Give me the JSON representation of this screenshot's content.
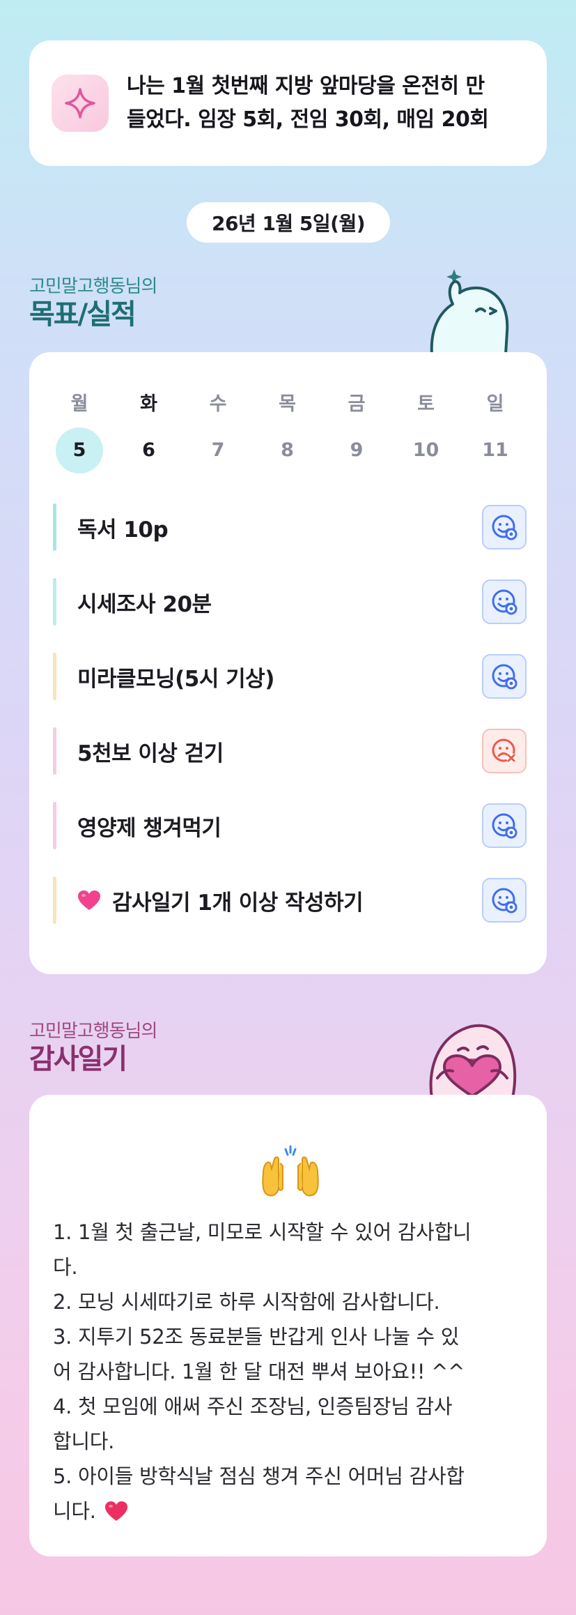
{
  "goal": {
    "line1": "나는 1월 첫번째 지방 앞마당을 온전히 만",
    "line2": "들었다. 임장 5회, 전임 30회, 매임 20회"
  },
  "date": "26년 1월 5일(월)",
  "goals_section": {
    "subtitle": "고민말고행동님의",
    "title": "목표/실적"
  },
  "week": {
    "days": [
      "월",
      "화",
      "수",
      "목",
      "금",
      "토",
      "일"
    ],
    "dates": [
      "5",
      "6",
      "7",
      "8",
      "9",
      "10",
      "11"
    ]
  },
  "tasks": [
    {
      "label": "독서 10p",
      "status": "done",
      "bar_color": "#a6e7e0"
    },
    {
      "label": "시세조사 20분",
      "status": "done",
      "bar_color": "#bfeaf0"
    },
    {
      "label": "미라클모닝(5시 기상)",
      "status": "done",
      "bar_color": "#fbe2bb"
    },
    {
      "label": "5천보 이상 걷기",
      "status": "failed",
      "bar_color": "#f7cbe1"
    },
    {
      "label": "영양제 챙겨먹기",
      "status": "done",
      "bar_color": "#f7cbe1"
    },
    {
      "label": "감사일기 1개 이상 작성하기",
      "status": "done",
      "bar_color": "#fbe2bb",
      "icon": "heart-icon"
    }
  ],
  "thanks_section": {
    "subtitle": "고민말고행동님의",
    "title": "감사일기"
  },
  "thanks": {
    "lines": [
      "1. 1월 첫 출근날, 미모로 시작할 수 있어 감사합니",
      "다.",
      "2. 모닝 시세따기로 하루 시작함에 감사합니다.",
      "3. 지투기 52조 동료분들 반갑게 인사 나눌 수 있",
      "어 감사합니다. 1월 한 달 대전 뿌셔 보아요!! ^^",
      "4. 첫 모임에 애써 주신 조장님, 인증팀장님 감사",
      "합니다.",
      "5. 아이들 방학식날 점심 챙겨 주신 어머님 감사합",
      "니다."
    ]
  },
  "colors": {
    "accent_teal": "#1e6e72",
    "accent_plum": "#8b2f6e",
    "done": "#3f6df0",
    "failed": "#ec5a45"
  }
}
